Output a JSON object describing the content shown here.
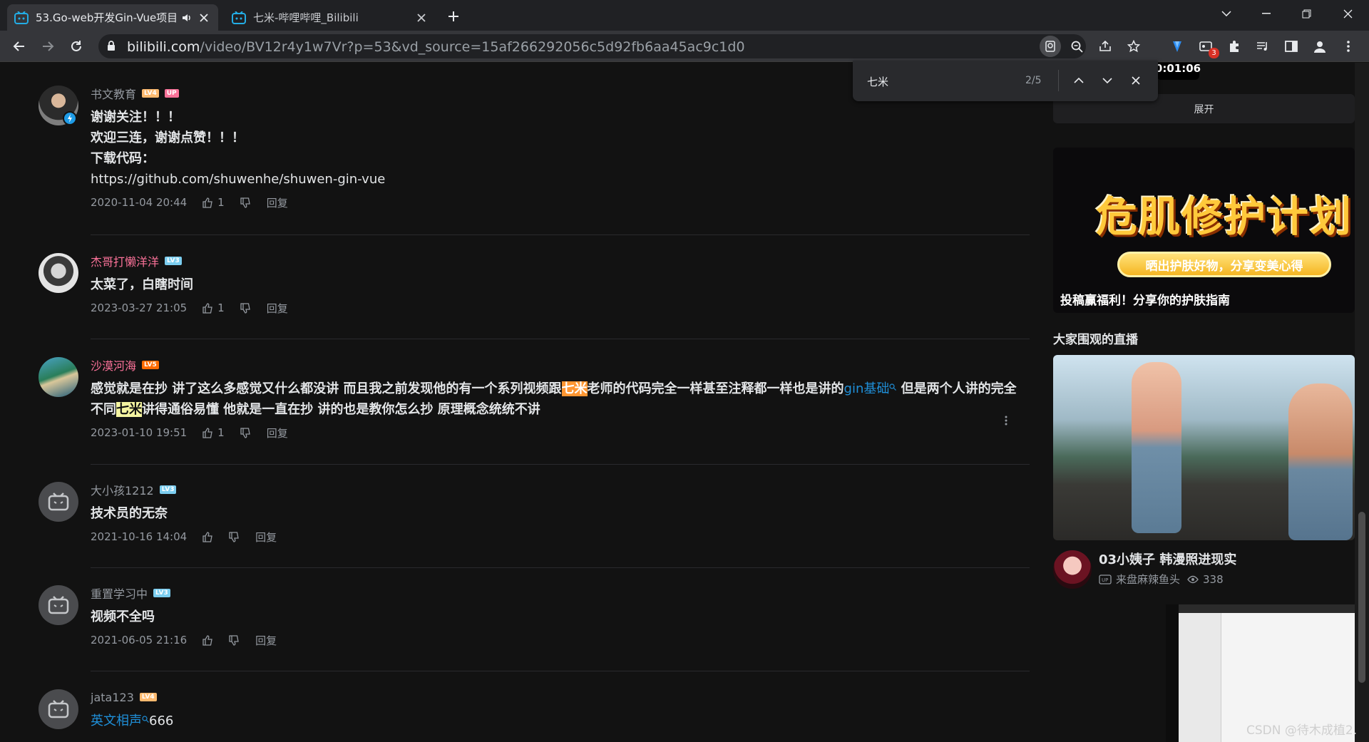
{
  "tabs": [
    {
      "title": "53.Go-web开发Gin-Vue项目",
      "audio": true,
      "active": true
    },
    {
      "title": "七米-哔哩哔哩_Bilibili",
      "audio": false,
      "active": false
    }
  ],
  "address": {
    "host": "bilibili.com",
    "path": "/video/BV12r4y1w7Vr?p=53&vd_source=15af266292056c5d92fb6aa45ac9c1d0"
  },
  "extension_badge": "3",
  "find": {
    "query": "七米",
    "count": "2/5"
  },
  "comments": [
    {
      "user": "书文教育",
      "level": "LV4",
      "up": "UP",
      "text": [
        "谢谢关注！！！",
        "欢迎三连，谢谢点赞！！！",
        "下载代码：",
        "https://github.com/shuwenhe/shuwen-gin-vue"
      ],
      "date": "2020-11-04 20:44",
      "likes": "1",
      "reply": "回复"
    },
    {
      "user": "杰哥打懒洋洋",
      "level": "LV3",
      "text": [
        "太菜了，白瞎时间"
      ],
      "date": "2023-03-27 21:05",
      "likes": "1",
      "reply": "回复"
    },
    {
      "user": "沙漠河海",
      "level": "LV5",
      "text_parts": {
        "a": "感觉就是在抄 讲了这么多感觉又什么都没讲 而且我之前发现他的有一个系列视频跟",
        "hl": "七米",
        "b": "老师的代码完全一样甚至注释都一样也是讲的",
        "link": "gin基础",
        "c": " 但是两个人讲的完全",
        "d": "不同",
        "hl2": "七米",
        "e": "讲得通俗易懂 他就是一直在抄 讲的也是教你怎么抄 原理概念统统不讲"
      },
      "date": "2023-01-10 19:51",
      "likes": "1",
      "reply": "回复"
    },
    {
      "user": "大小孩1212",
      "level": "LV3",
      "text": [
        "技术员的无奈"
      ],
      "date": "2021-10-16 14:04",
      "likes": "",
      "reply": "回复"
    },
    {
      "user": "重置学习中",
      "level": "LV3",
      "text": [
        "视频不全吗"
      ],
      "date": "2021-06-05 21:16",
      "likes": "",
      "reply": "回复"
    },
    {
      "user": "jata123",
      "level": "LV4",
      "link": "英文相声",
      "text_after": "666"
    }
  ],
  "sidebar": {
    "thumb_time": "0:01:06",
    "expand_label": "展开",
    "banner_title": "危肌修护计划",
    "banner_pill": "晒出护肤好物，分享变美心得",
    "banner_caption": "投稿赢福利！分享你的护肤指南",
    "section_title": "大家围观的直播",
    "live_title": "03小姨子 韩漫照进现实",
    "live_streamer": "来盘麻辣鱼头",
    "live_viewers": "338"
  },
  "watermark": "CSDN @待木成植2."
}
